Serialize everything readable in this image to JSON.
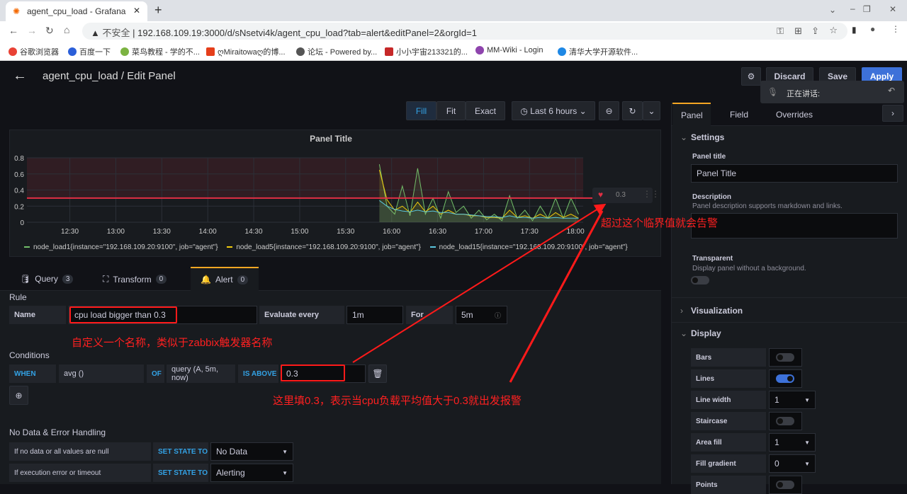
{
  "browser": {
    "tab_title": "agent_cpu_load - Grafana",
    "insecure_label": "不安全",
    "url": "192.168.109.19:3000/d/sNsetvi4k/agent_cpu_load?tab=alert&editPanel=2&orgId=1",
    "bookmarks": [
      "谷歌浏览器",
      "百度一下",
      "菜鸟教程 - 学的不...",
      "ღMiraitowaღ的博...",
      "论坛 - Powered by...",
      "小小宇宙213321的...",
      "MM-Wiki - Login",
      "清华大学开源软件..."
    ]
  },
  "header": {
    "title": "agent_cpu_load / Edit Panel",
    "discard": "Discard",
    "save": "Save",
    "apply": "Apply",
    "voice_popup": "正在讲话:"
  },
  "toolbar": {
    "fill": "Fill",
    "fit": "Fit",
    "exact": "Exact",
    "time_range": "Last 6 hours"
  },
  "chart_data": {
    "type": "line",
    "title": "Panel Title",
    "ylim": [
      0,
      0.8
    ],
    "yticks": [
      "0",
      "0.2",
      "0.4",
      "0.6",
      "0.8"
    ],
    "xticks": [
      "12:30",
      "13:00",
      "13:30",
      "14:00",
      "14:30",
      "15:00",
      "15:30",
      "16:00",
      "16:30",
      "17:00",
      "17:30",
      "18:00"
    ],
    "xrange_minutes": [
      722,
      1085
    ],
    "threshold": 0.3,
    "threshold_label": "0.3",
    "x_start_minute": 952,
    "x_step_minutes": 5,
    "series": [
      {
        "name": "node_load1{instance=\"192.168.109.20:9100\", job=\"agent\"}",
        "color": "#73bf69",
        "values": [
          0.72,
          0.2,
          0.1,
          0.45,
          0.08,
          0.67,
          0.1,
          0.3,
          0.05,
          0.38,
          0.12,
          0.2,
          0.05,
          0.15,
          0.03,
          0.1,
          0.02,
          0.33,
          0.05,
          0.15,
          0.02,
          0.2,
          0.05,
          0.3,
          0.05,
          0.3,
          0.1
        ]
      },
      {
        "name": "node_load5{instance=\"192.168.109.20:9100\", job=\"agent\"}",
        "color": "#f2cc0c",
        "values": [
          0.65,
          0.28,
          0.15,
          0.2,
          0.12,
          0.25,
          0.13,
          0.2,
          0.1,
          0.15,
          0.1,
          0.1,
          0.08,
          0.08,
          0.06,
          0.06,
          0.05,
          0.15,
          0.06,
          0.08,
          0.05,
          0.1,
          0.05,
          0.12,
          0.06,
          0.1,
          0.05
        ]
      },
      {
        "name": "node_load15{instance=\"192.168.109.20:9100\", job=\"agent\"}",
        "color": "#5ac7de",
        "values": [
          0.27,
          0.2,
          0.16,
          0.14,
          0.13,
          0.15,
          0.13,
          0.14,
          0.12,
          0.12,
          0.1,
          0.1,
          0.09,
          0.08,
          0.07,
          0.07,
          0.06,
          0.08,
          0.06,
          0.06,
          0.05,
          0.06,
          0.05,
          0.06,
          0.05,
          0.05,
          0.05
        ]
      }
    ]
  },
  "tabs": [
    {
      "label": "Query",
      "count": "3"
    },
    {
      "label": "Transform",
      "count": "0"
    },
    {
      "label": "Alert",
      "count": "0"
    }
  ],
  "alert": {
    "rule_heading": "Rule",
    "name_label": "Name",
    "name_value": "cpu load bigger than 0.3",
    "evaluate_label": "Evaluate every",
    "evaluate_value": "1m",
    "for_label": "For",
    "for_value": "5m",
    "conditions_heading": "Conditions",
    "when": "WHEN",
    "reducer": "avg ()",
    "of": "OF",
    "query": "query (A, 5m, now)",
    "evaluator": "IS ABOVE",
    "threshold": "0.3",
    "nodata_heading": "No Data & Error Handling",
    "nodata_label": "If no data or all values are null",
    "set_state": "SET STATE TO",
    "nodata_value": "No Data",
    "error_label": "If execution error or timeout",
    "error_value": "Alerting"
  },
  "annotations": {
    "threshold_note": "超过这个临界值就会告警",
    "name_note": "自定义一个名称，类似于zabbix触发器名称",
    "value_note": "这里填0.3，表示当cpu负载平均值大于0.3就出发报警"
  },
  "options": {
    "tabs": [
      "Panel",
      "Field",
      "Overrides"
    ],
    "settings": "Settings",
    "panel_title_label": "Panel title",
    "panel_title_value": "Panel Title",
    "description_label": "Description",
    "description_hint": "Panel description supports markdown and links.",
    "transparent_label": "Transparent",
    "transparent_hint": "Display panel without a background.",
    "visualization": "Visualization",
    "display": "Display",
    "rows": [
      {
        "label": "Bars",
        "type": "switch",
        "on": false
      },
      {
        "label": "Lines",
        "type": "switch",
        "on": true
      },
      {
        "label": "Line width",
        "type": "select",
        "value": "1"
      },
      {
        "label": "Staircase",
        "type": "switch",
        "on": false
      },
      {
        "label": "Area fill",
        "type": "select",
        "value": "1"
      },
      {
        "label": "Fill gradient",
        "type": "select",
        "value": "0"
      },
      {
        "label": "Points",
        "type": "switch",
        "on": false
      }
    ]
  }
}
